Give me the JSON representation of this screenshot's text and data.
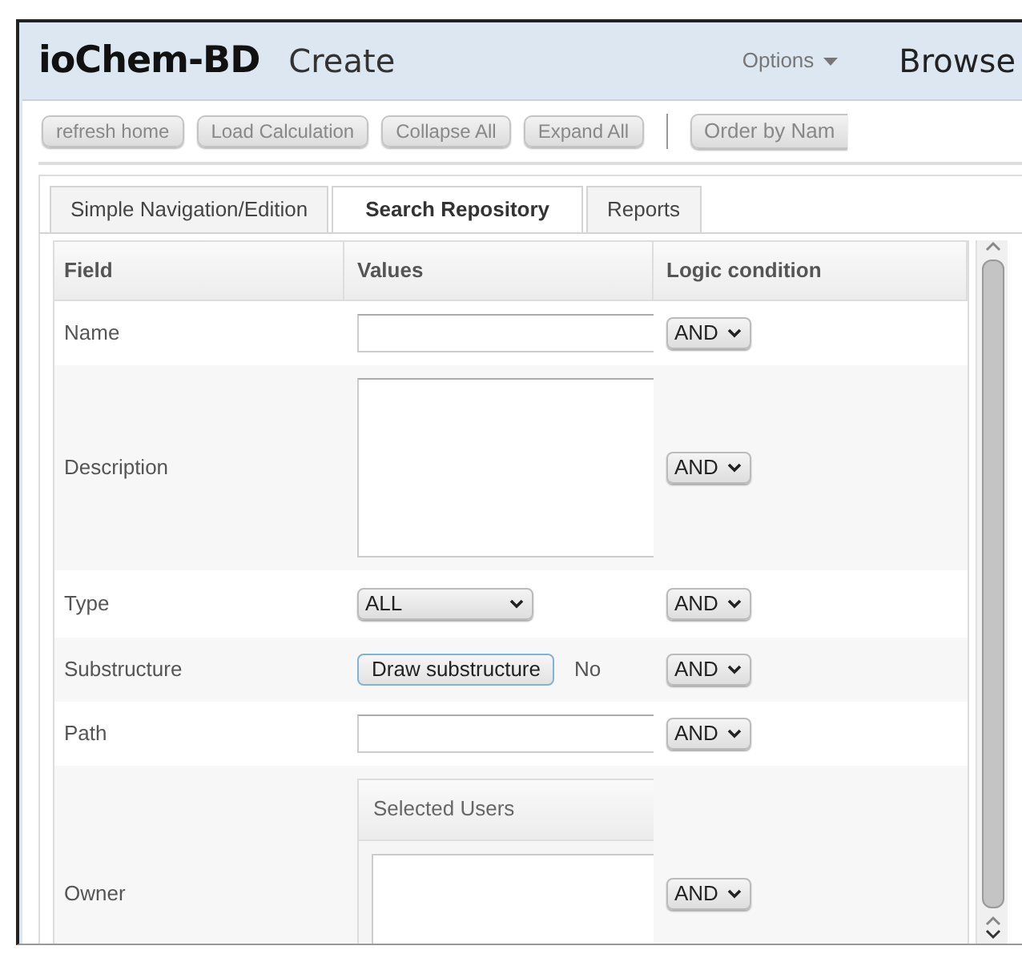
{
  "header": {
    "brand": "ioChem-BD",
    "section": "Create",
    "options": "Options",
    "browse": "Browse"
  },
  "toolbar": [
    "refresh home",
    "Load Calculation",
    "Collapse All",
    "Expand All"
  ],
  "order_button": "Order by Nam",
  "tabs": [
    {
      "label": "Simple Navigation/Edition",
      "selected": false
    },
    {
      "label": "Search Repository",
      "selected": true
    },
    {
      "label": "Reports",
      "selected": false
    }
  ],
  "table": {
    "columns": [
      "Field",
      "Values",
      "Logic condition"
    ],
    "rows": [
      {
        "field": "Name",
        "kind": "text",
        "logic": "AND"
      },
      {
        "field": "Description",
        "kind": "textarea",
        "logic": "AND"
      },
      {
        "field": "Type",
        "kind": "select",
        "value": "ALL",
        "logic": "AND"
      },
      {
        "field": "Substructure",
        "kind": "draw",
        "button": "Draw substructure",
        "note": "No",
        "logic": "AND"
      },
      {
        "field": "Path",
        "kind": "text",
        "logic": "AND"
      },
      {
        "field": "Owner",
        "kind": "owner",
        "panel_title": "Selected Users",
        "logic": "AND"
      }
    ]
  }
}
